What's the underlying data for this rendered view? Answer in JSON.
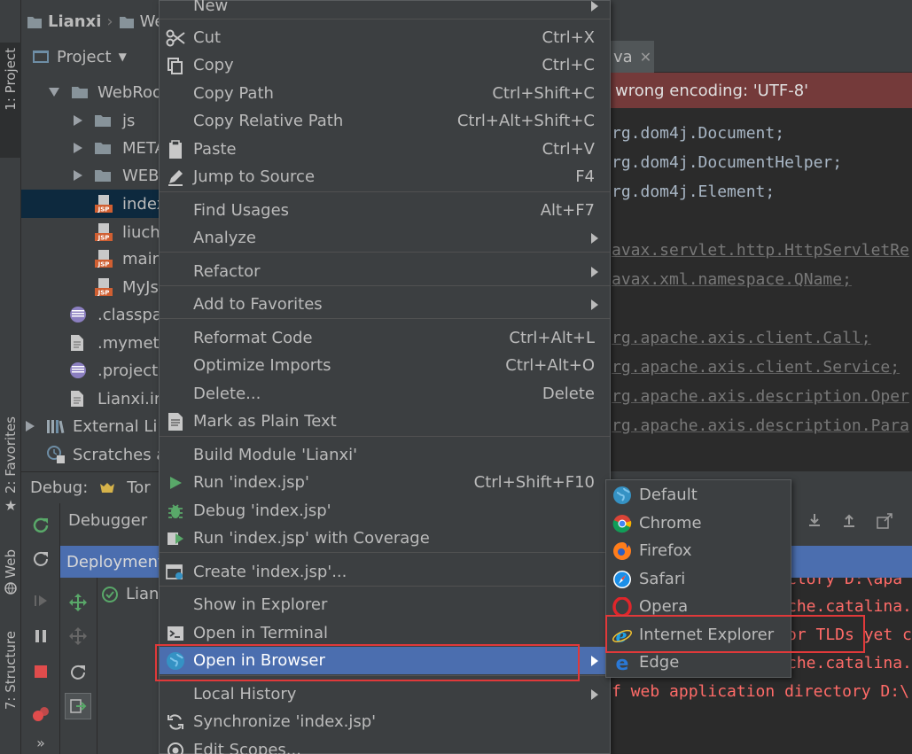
{
  "breadcrumb": {
    "project": "Lianxi",
    "folder": "WebR"
  },
  "project_panel": {
    "title": "Project"
  },
  "tree": [
    {
      "label": "WebRoo",
      "kind": "folder",
      "expanded": true
    },
    {
      "label": "js",
      "kind": "folder"
    },
    {
      "label": "META",
      "kind": "folder"
    },
    {
      "label": "WEB-",
      "kind": "folder"
    },
    {
      "label": "index",
      "kind": "jsp",
      "selected": true
    },
    {
      "label": "liuch",
      "kind": "jsp"
    },
    {
      "label": "main",
      "kind": "jsp"
    },
    {
      "label": "MyJs",
      "kind": "jsp"
    },
    {
      "label": ".classpat",
      "kind": "eclipse"
    },
    {
      "label": ".mymeta",
      "kind": "file"
    },
    {
      "label": ".project",
      "kind": "eclipse"
    },
    {
      "label": "Lianxi.im",
      "kind": "file"
    },
    {
      "label": "External Lib",
      "kind": "library"
    },
    {
      "label": "Scratches a",
      "kind": "scratch"
    }
  ],
  "left_strip": {
    "project_tab": "1: Project",
    "favorites_tab": "2: Favorites",
    "web_tab": "Web",
    "structure_tab": "7: Structure"
  },
  "editor": {
    "tab_fragment": "va",
    "encoding_warning": "wrong encoding: 'UTF-8'",
    "lines": [
      {
        "text": "rg.dom4j.Document;",
        "style": "imp"
      },
      {
        "text": "rg.dom4j.DocumentHelper;",
        "style": "imp"
      },
      {
        "text": "rg.dom4j.Element;",
        "style": "imp"
      },
      {
        "text": "",
        "style": "imp"
      },
      {
        "text": "avax.servlet.http.HttpServletRe",
        "style": "unused"
      },
      {
        "text": "avax.xml.namespace.QName;",
        "style": "unused"
      },
      {
        "text": "",
        "style": "imp"
      },
      {
        "text": "rg.apache.axis.client.Call;",
        "style": "unused"
      },
      {
        "text": "rg.apache.axis.client.Service;",
        "style": "unused"
      },
      {
        "text": "rg.apache.axis.description.Oper",
        "style": "unused"
      },
      {
        "text": "rg.apache.axis.description.Para",
        "style": "unused"
      }
    ]
  },
  "debug": {
    "label": "Debug:",
    "run_config": "Tor",
    "debugger_tab": "Debugger",
    "deployment_label": "Deployment",
    "deploy_item": "Lian"
  },
  "console_lines": [
    {
      "text": "ctory D:\\apa",
      "indent": 200
    },
    {
      "text": "che.catalina.",
      "indent": 200
    },
    {
      "text": "or TLDs yet c",
      "indent": 200
    },
    {
      "text": "che.catalina.",
      "indent": 200
    },
    {
      "text": "f web application directory D:\\",
      "indent": 0
    }
  ],
  "context_menu": {
    "items": [
      {
        "label": "New",
        "shortcut": "",
        "submenu": true,
        "icon": ""
      },
      {
        "label": "Cut",
        "shortcut": "Ctrl+X",
        "icon": "scissors-icon"
      },
      {
        "label": "Copy",
        "shortcut": "Ctrl+C",
        "icon": "copy-icon"
      },
      {
        "label": "Copy Path",
        "shortcut": "Ctrl+Shift+C",
        "icon": ""
      },
      {
        "label": "Copy Relative Path",
        "shortcut": "Ctrl+Alt+Shift+C",
        "icon": ""
      },
      {
        "label": "Paste",
        "shortcut": "Ctrl+V",
        "icon": "clipboard-icon"
      },
      {
        "label": "Jump to Source",
        "shortcut": "F4",
        "icon": "pencil-icon"
      },
      {
        "label": "Find Usages",
        "shortcut": "Alt+F7",
        "icon": ""
      },
      {
        "label": "Analyze",
        "shortcut": "",
        "submenu": true,
        "icon": ""
      },
      {
        "label": "Refactor",
        "shortcut": "",
        "submenu": true,
        "icon": ""
      },
      {
        "label": "Add to Favorites",
        "shortcut": "",
        "submenu": true,
        "icon": ""
      },
      {
        "label": "Reformat Code",
        "shortcut": "Ctrl+Alt+L",
        "icon": ""
      },
      {
        "label": "Optimize Imports",
        "shortcut": "Ctrl+Alt+O",
        "icon": ""
      },
      {
        "label": "Delete...",
        "shortcut": "Delete",
        "icon": ""
      },
      {
        "label": "Mark as Plain Text",
        "shortcut": "",
        "icon": "plain-text-icon"
      },
      {
        "label": "Build Module 'Lianxi'",
        "shortcut": "",
        "icon": ""
      },
      {
        "label": "Run 'index.jsp'",
        "shortcut": "Ctrl+Shift+F10",
        "icon": "run-icon"
      },
      {
        "label": "Debug 'index.jsp'",
        "shortcut": "",
        "icon": "debug-bug-icon"
      },
      {
        "label": "Run 'index.jsp' with Coverage",
        "shortcut": "",
        "icon": "coverage-icon"
      },
      {
        "label": "Create 'index.jsp'...",
        "shortcut": "",
        "icon": "create-config-icon"
      },
      {
        "label": "Show in Explorer",
        "shortcut": "",
        "icon": ""
      },
      {
        "label": "Open in Terminal",
        "shortcut": "",
        "icon": "terminal-icon"
      },
      {
        "label": "Open in Browser",
        "shortcut": "",
        "submenu": true,
        "highlighted": true,
        "icon": "globe-icon"
      },
      {
        "label": "Local History",
        "shortcut": "",
        "submenu": true,
        "icon": ""
      },
      {
        "label": "Synchronize 'index.jsp'",
        "shortcut": "",
        "icon": "sync-icon"
      },
      {
        "label": "Edit Scopes...",
        "shortcut": "",
        "icon": "scopes-icon"
      }
    ]
  },
  "browser_submenu": [
    {
      "label": "Default",
      "icon": "globe-icon"
    },
    {
      "label": "Chrome",
      "icon": "chrome-icon"
    },
    {
      "label": "Firefox",
      "icon": "firefox-icon"
    },
    {
      "label": "Safari",
      "icon": "safari-icon"
    },
    {
      "label": "Opera",
      "icon": "opera-icon"
    },
    {
      "label": "Internet Explorer",
      "icon": "internet-explorer-icon"
    },
    {
      "label": "Edge",
      "icon": "edge-icon"
    }
  ],
  "colors": {
    "background": "#3c3f41",
    "editor_bg": "#2b2b2b",
    "selection": "#4b6eaf",
    "annotation_red": "#e0393a",
    "console_error": "#ff6b68"
  }
}
